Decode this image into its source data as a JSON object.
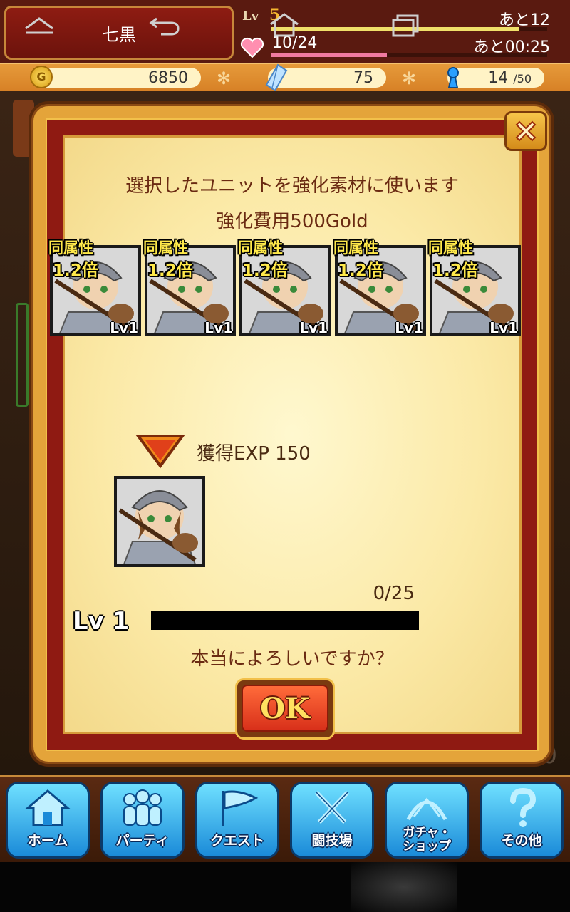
{
  "player": {
    "name": "七黒",
    "lv_label": "Lv",
    "level": "5",
    "exp_remaining": "あと12",
    "exp_progress": 0.9,
    "stamina": "10/24",
    "stamina_timer": "あと00:25",
    "stamina_progress": 0.42
  },
  "resources": {
    "gold_icon": "G",
    "gold": "6850",
    "crystals": "75",
    "units": "14",
    "units_max": "/50"
  },
  "dialog": {
    "message": "選択したユニットを強化素材に使います",
    "cost": "強化費用500Gold",
    "materials": [
      {
        "badge_line1": "同属性",
        "badge_line2": "1.2倍",
        "level": "Lv1"
      },
      {
        "badge_line1": "同属性",
        "badge_line2": "1.2倍",
        "level": "Lv1"
      },
      {
        "badge_line1": "同属性",
        "badge_line2": "1.2倍",
        "level": "Lv1"
      },
      {
        "badge_line1": "同属性",
        "badge_line2": "1.2倍",
        "level": "Lv1"
      },
      {
        "badge_line1": "同属性",
        "badge_line2": "1.2倍",
        "level": "Lv1"
      }
    ],
    "gain_exp": "獲得EXP 150",
    "exp_count": "0/25",
    "target_level": "Lv 1",
    "target_exp_progress": 0,
    "confirm": "本当によろしいですか？",
    "ok_label": "OK"
  },
  "background": {
    "partial_number": "0"
  },
  "nav": {
    "home": "ホーム",
    "party": "パーティ",
    "quest": "クエスト",
    "arena": "闘技場",
    "gacha_line1": "ガチャ・",
    "gacha_line2": "ショップ",
    "other": "その他"
  },
  "icons": [
    "heart-icon",
    "gold-coin-icon",
    "crystal-icon",
    "unit-icon",
    "close-icon",
    "arrow-down-icon",
    "home-icon",
    "party-icon",
    "quest-flag-icon",
    "arena-swords-icon",
    "gacha-icon",
    "question-icon",
    "android-back-icon",
    "android-home-icon",
    "android-recents-icon"
  ],
  "colors": {
    "accent_red": "#8f1a12",
    "panel_cream": "#fbe9a6",
    "nav_blue": "#1a8ad8",
    "gold": "#f5b730"
  }
}
